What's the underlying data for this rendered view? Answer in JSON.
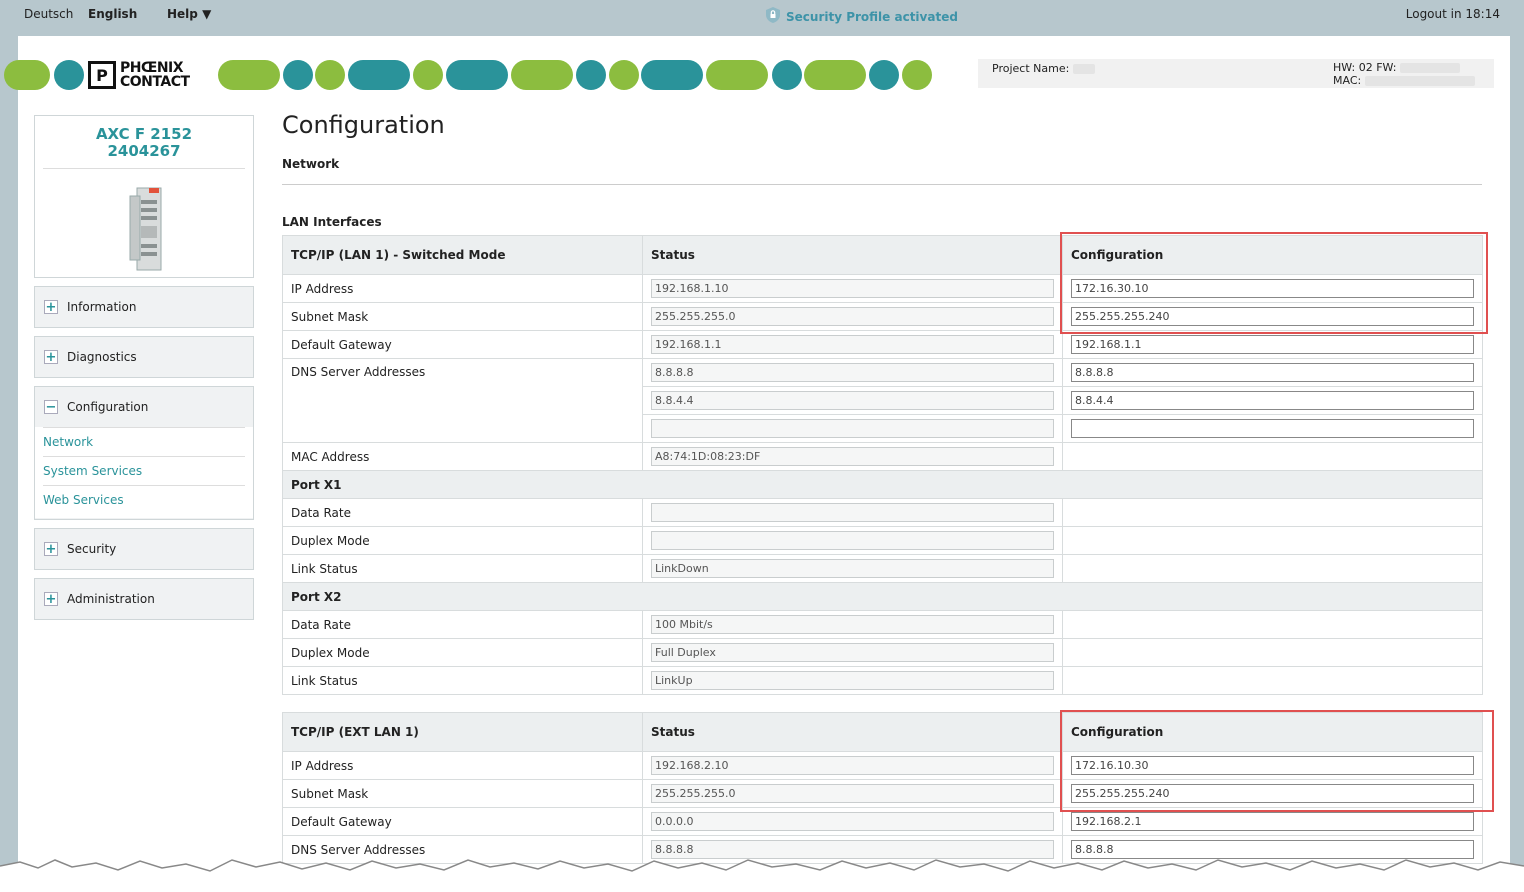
{
  "topbar": {
    "lang_de": "Deutsch",
    "lang_en": "English",
    "help": "Help ▼",
    "security": "Security Profile activated",
    "logout": "Logout in 18:14"
  },
  "brand": {
    "logo_line1": "PHŒNIX",
    "logo_line2": "CONTACT",
    "green": "#8cbd3f",
    "teal": "#2a939a"
  },
  "project": {
    "name_label": "Project Name:",
    "hw_label": "HW: 02 FW:",
    "mac_label": "MAC:"
  },
  "device": {
    "model": "AXC F 2152",
    "part": "2404267"
  },
  "sidebar": {
    "information": "Information",
    "diagnostics": "Diagnostics",
    "configuration": "Configuration",
    "config_items": [
      "Network",
      "System Services",
      "Web Services"
    ],
    "security": "Security",
    "administration": "Administration"
  },
  "page": {
    "title": "Configuration",
    "subtitle": "Network",
    "section": "LAN Interfaces"
  },
  "lan1": {
    "header": "TCP/IP (LAN 1) - Switched Mode",
    "status_header": "Status",
    "config_header": "Configuration",
    "ip_label": "IP Address",
    "ip_status": "192.168.1.10",
    "ip_config": "172.16.30.10",
    "mask_label": "Subnet Mask",
    "mask_status": "255.255.255.0",
    "mask_config": "255.255.255.240",
    "gw_label": "Default Gateway",
    "gw_status": "192.168.1.1",
    "gw_config": "192.168.1.1",
    "dns_label": "DNS Server Addresses",
    "dns1_status": "8.8.8.8",
    "dns1_config": "8.8.8.8",
    "dns2_status": "8.8.4.4",
    "dns2_config": "8.8.4.4",
    "dns3_status": "",
    "dns3_config": "",
    "mac_label": "MAC Address",
    "mac_status": "A8:74:1D:08:23:DF",
    "port1": "Port X1",
    "p1_rate_label": "Data Rate",
    "p1_rate": "",
    "p1_duplex_label": "Duplex Mode",
    "p1_duplex": "",
    "p1_link_label": "Link Status",
    "p1_link": "LinkDown",
    "port2": "Port X2",
    "p2_rate_label": "Data Rate",
    "p2_rate": "100 Mbit/s",
    "p2_duplex_label": "Duplex Mode",
    "p2_duplex": "Full Duplex",
    "p2_link_label": "Link Status",
    "p2_link": "LinkUp"
  },
  "ext": {
    "header": "TCP/IP (EXT LAN 1)",
    "status_header": "Status",
    "config_header": "Configuration",
    "ip_label": "IP Address",
    "ip_status": "192.168.2.10",
    "ip_config": "172.16.10.30",
    "mask_label": "Subnet Mask",
    "mask_status": "255.255.255.0",
    "mask_config": "255.255.255.240",
    "gw_label": "Default Gateway",
    "gw_status": "0.0.0.0",
    "gw_config": "192.168.2.1",
    "dns_label": "DNS Server Addresses",
    "dns1_status": "8.8.8.8",
    "dns1_config": "8.8.8.8"
  }
}
